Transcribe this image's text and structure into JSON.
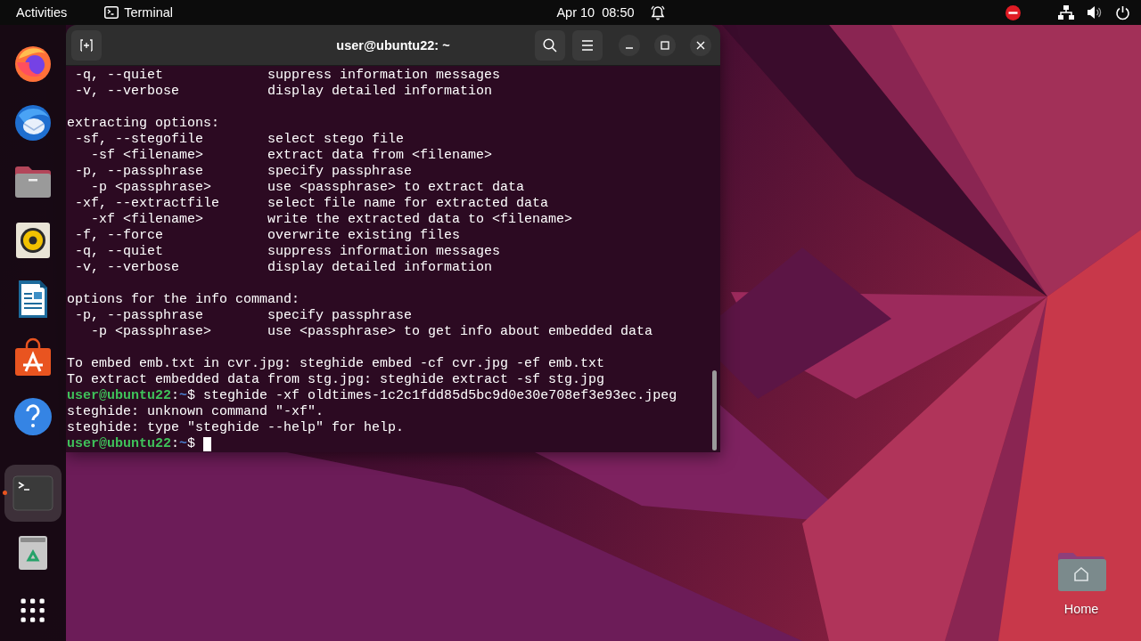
{
  "top_bar": {
    "activities": "Activities",
    "app_name": "Terminal",
    "clock": "Apr 10  08:50",
    "do_not_disturb": true
  },
  "dock": [
    {
      "kind": "browser",
      "running": false,
      "selected": false
    },
    {
      "kind": "mail",
      "running": false,
      "selected": false
    },
    {
      "kind": "files",
      "running": false,
      "selected": false
    },
    {
      "kind": "music",
      "running": false,
      "selected": false
    },
    {
      "kind": "writer",
      "running": false,
      "selected": false
    },
    {
      "kind": "store",
      "running": false,
      "selected": false
    },
    {
      "kind": "help",
      "running": false,
      "selected": false
    },
    {
      "kind": "terminal",
      "running": true,
      "selected": true
    },
    {
      "kind": "trash",
      "running": false,
      "selected": false
    },
    {
      "kind": "apps",
      "running": false,
      "selected": false
    }
  ],
  "window": {
    "title": "user@ubuntu22: ~",
    "lines": [
      {
        "kind": "option",
        "option": "-q, --quiet",
        "description": "suppress information messages"
      },
      {
        "kind": "option",
        "option": "-v, --verbose",
        "description": "display detailed information"
      },
      {
        "kind": "blank"
      },
      {
        "kind": "text",
        "text": "extracting options:"
      },
      {
        "kind": "option",
        "option": "-sf, --stegofile",
        "description": "select stego file"
      },
      {
        "kind": "suboption",
        "option": "-sf <filename>",
        "description": "extract data from <filename>"
      },
      {
        "kind": "option",
        "option": "-p, --passphrase",
        "description": "specify passphrase"
      },
      {
        "kind": "suboption",
        "option": "-p <passphrase>",
        "description": "use <passphrase> to extract data"
      },
      {
        "kind": "option",
        "option": "-xf, --extractfile",
        "description": "select file name for extracted data"
      },
      {
        "kind": "suboption",
        "option": "-xf <filename>",
        "description": "write the extracted data to <filename>"
      },
      {
        "kind": "option",
        "option": "-f, --force",
        "description": "overwrite existing files"
      },
      {
        "kind": "option",
        "option": "-q, --quiet",
        "description": "suppress information messages"
      },
      {
        "kind": "option",
        "option": "-v, --verbose",
        "description": "display detailed information"
      },
      {
        "kind": "blank"
      },
      {
        "kind": "text",
        "text": "options for the info command:"
      },
      {
        "kind": "option",
        "option": "-p, --passphrase",
        "description": "specify passphrase"
      },
      {
        "kind": "suboption",
        "option": "-p <passphrase>",
        "description": "use <passphrase> to get info about embedded data"
      },
      {
        "kind": "blank"
      },
      {
        "kind": "text",
        "text": "To embed emb.txt in cvr.jpg: steghide embed -cf cvr.jpg -ef emb.txt"
      },
      {
        "kind": "text",
        "text": "To extract embedded data from stg.jpg: steghide extract -sf stg.jpg"
      },
      {
        "kind": "prompt",
        "host": "user@ubuntu22",
        "sep": ":",
        "path": "~",
        "sign": "$",
        "command": "steghide -xf oldtimes-1c2c1fdd85d5bc9d0e30e708ef3e93ec.jpeg",
        "cursor": false
      },
      {
        "kind": "text",
        "text": "steghide: unknown command \"-xf\"."
      },
      {
        "kind": "text",
        "text": "steghide: type \"steghide --help\" for help."
      },
      {
        "kind": "prompt",
        "host": "user@ubuntu22",
        "sep": ":",
        "path": "~",
        "sign": "$",
        "cursor": true
      }
    ]
  },
  "desktop_icons": [
    {
      "label": "Home"
    }
  ]
}
